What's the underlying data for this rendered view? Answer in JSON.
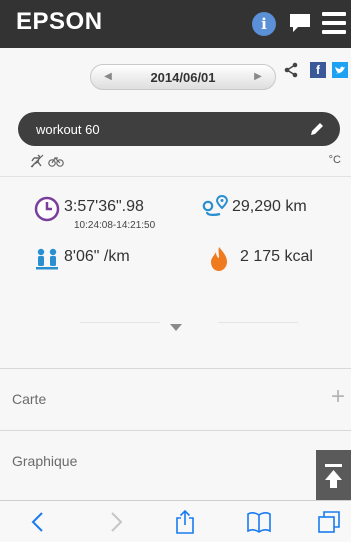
{
  "header": {
    "brand": "EPSON",
    "icons": [
      "info-icon",
      "chat-icon",
      "menu-icon"
    ]
  },
  "date_nav": {
    "date": "2014/06/01",
    "share_icons": [
      "share-icon",
      "facebook-icon",
      "twitter-icon"
    ]
  },
  "workout": {
    "name": "workout 60",
    "temperature_unit": "°C"
  },
  "stats": {
    "duration": "3:57'36\".98",
    "time_range": "10:24:08-14:21:50",
    "distance": "29,290 km",
    "pace": "8'06\" /km",
    "calories": "2 175 kcal"
  },
  "sections": [
    {
      "label": "Carte",
      "expand": "+"
    },
    {
      "label": "Graphique",
      "expand": "+"
    }
  ],
  "colors": {
    "header_bg": "#333333",
    "clock": "#7a3e9d",
    "route": "#2a8fd0",
    "pace": "#2a8fd0",
    "flame": "#f07a1e",
    "ios_blue": "#1a7cf0"
  }
}
